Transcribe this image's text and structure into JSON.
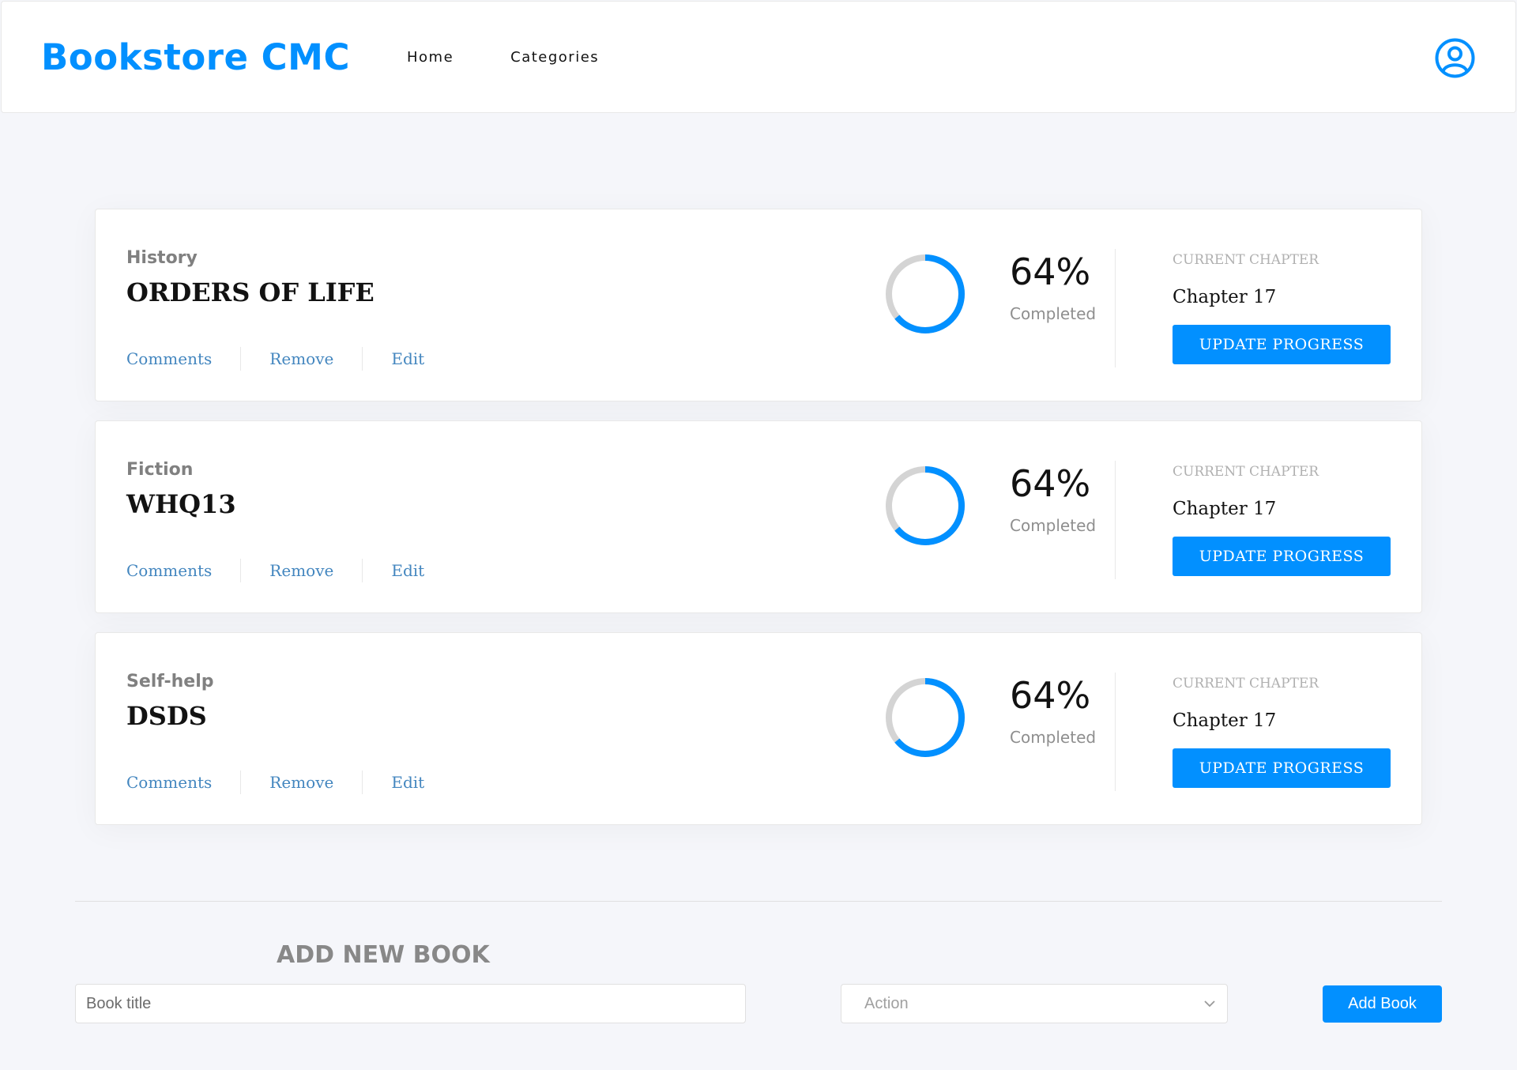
{
  "header": {
    "logo": "Bookstore CMC",
    "nav": [
      {
        "label": "Home"
      },
      {
        "label": "Categories"
      }
    ],
    "user_icon": "user-circle-icon"
  },
  "books": [
    {
      "genre": "History",
      "title": "ORDERS OF LIFE",
      "actions": {
        "comments": "Comments",
        "remove": "Remove",
        "edit": "Edit"
      },
      "progress_percent": 64,
      "progress_text": "64%",
      "completed_label": "Completed",
      "current_chapter_label": "CURRENT CHAPTER",
      "chapter": "Chapter 17",
      "update_label": "UPDATE PROGRESS"
    },
    {
      "genre": "Fiction",
      "title": "WHQ13",
      "actions": {
        "comments": "Comments",
        "remove": "Remove",
        "edit": "Edit"
      },
      "progress_percent": 64,
      "progress_text": "64%",
      "completed_label": "Completed",
      "current_chapter_label": "CURRENT CHAPTER",
      "chapter": "Chapter 17",
      "update_label": "UPDATE PROGRESS"
    },
    {
      "genre": "Self-help",
      "title": "DSDS",
      "actions": {
        "comments": "Comments",
        "remove": "Remove",
        "edit": "Edit"
      },
      "progress_percent": 64,
      "progress_text": "64%",
      "completed_label": "Completed",
      "current_chapter_label": "CURRENT CHAPTER",
      "chapter": "Chapter 17",
      "update_label": "UPDATE PROGRESS"
    }
  ],
  "add_form": {
    "title": "ADD NEW BOOK",
    "title_placeholder": "Book title",
    "category_selected": "Action",
    "submit_label": "Add Book"
  },
  "colors": {
    "accent": "#0290ff",
    "ring_track": "#d4d4d4",
    "link": "#4386bf",
    "background": "#f5f6fa"
  }
}
